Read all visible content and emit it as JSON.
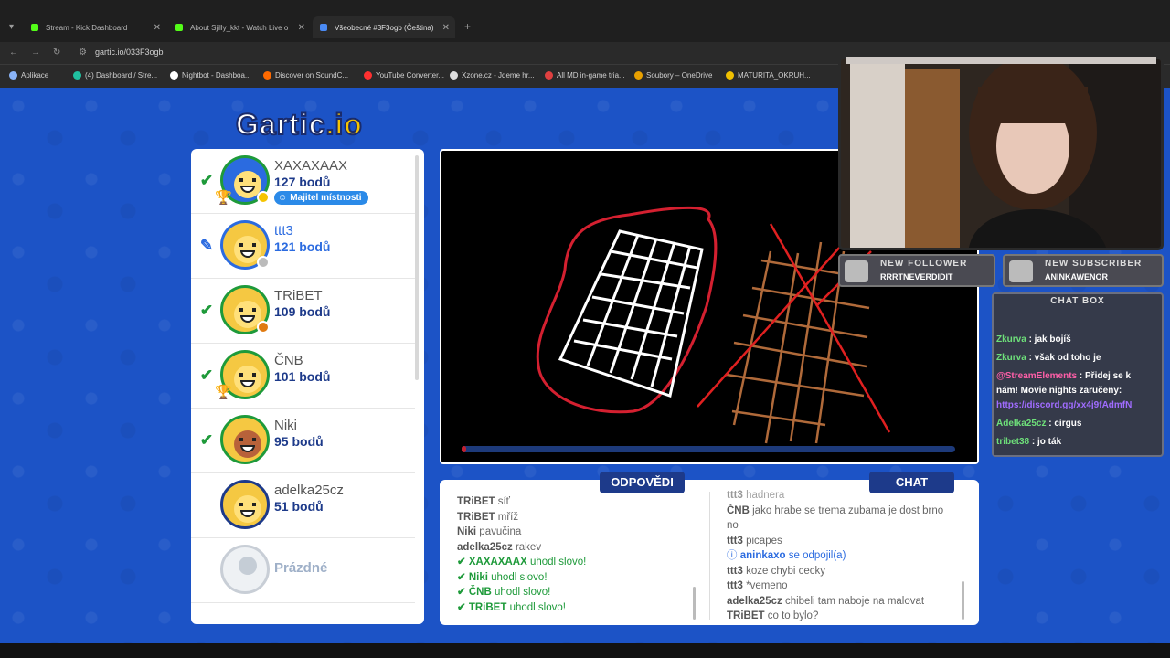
{
  "browser": {
    "tabs": [
      {
        "label": "Stream - Kick Dashboard",
        "color": "#53fc18"
      },
      {
        "label": "About Sjilly_kkt - Watch Live o",
        "color": "#53fc18"
      },
      {
        "label": "Všeobecné #3F3ogb (Čeština)",
        "color": "#4a8af4"
      }
    ],
    "new_tab": "+",
    "url": "gartic.io/033F3ogb",
    "bookmarks": [
      {
        "label": "Aplikace",
        "color": "#8ab4f8"
      },
      {
        "label": "(4) Dashboard / Stre...",
        "color": "#20c0a0"
      },
      {
        "label": "Nightbot - Dashboa...",
        "color": "#ffffff"
      },
      {
        "label": "Discover on SoundC...",
        "color": "#ff6a00"
      },
      {
        "label": "YouTube Converter...",
        "color": "#ff3030"
      },
      {
        "label": "Xzone.cz - Jdeme hr...",
        "color": "#dddddd"
      },
      {
        "label": "All MD in-game tria...",
        "color": "#e04040"
      },
      {
        "label": "Soubory – OneDrive",
        "color": "#e8a000"
      },
      {
        "label": "MATURITA_OKRUH...",
        "color": "#f0c000"
      }
    ]
  },
  "game": {
    "logo_main": "Gartic",
    "logo_suffix": ".io",
    "players": [
      {
        "name": "XAXAXAAX",
        "points": "127 bodů",
        "status": "check",
        "owner_badge": "Majitel místnosti",
        "trophy": true,
        "dot": "#f5c400",
        "hair": "#2b6be0"
      },
      {
        "name": "ttt3",
        "points": "121 bodů",
        "status": "pencil",
        "drawer": true,
        "dot": "#bbbbbb"
      },
      {
        "name": "TRiBET",
        "points": "109 bodů",
        "status": "check",
        "dot": "#e07a10"
      },
      {
        "name": "ČNB",
        "points": "101 bodů",
        "status": "check",
        "trophy": true
      },
      {
        "name": "Niki",
        "points": "95 bodů",
        "status": "check",
        "skin": "#b8623a"
      },
      {
        "name": "adelka25cz",
        "points": "51 bodů",
        "status": "none"
      },
      {
        "name": "Prázdné",
        "points": "",
        "status": "empty"
      }
    ],
    "timer_fraction": 0.01,
    "tabs": {
      "answers": "ODPOVĚDI",
      "chat": "CHAT"
    },
    "answers": [
      {
        "user": "TRiBET",
        "text": "síť",
        "type": "guess"
      },
      {
        "user": "TRiBET",
        "text": "mříž",
        "type": "guess"
      },
      {
        "user": "Niki",
        "text": "pavučina",
        "type": "guess"
      },
      {
        "user": "adelka25cz",
        "text": "rakev",
        "type": "guess"
      },
      {
        "user": "XAXAXAAX",
        "text": "uhodl slovo!",
        "type": "correct"
      },
      {
        "user": "Niki",
        "text": "uhodl slovo!",
        "type": "correct"
      },
      {
        "user": "ČNB",
        "text": "uhodl slovo!",
        "type": "correct"
      },
      {
        "user": "TRiBET",
        "text": "uhodl slovo!",
        "type": "correct"
      }
    ],
    "chat": [
      {
        "user": "ttt3",
        "text": "hadnera",
        "type": "msg"
      },
      {
        "user": "ČNB",
        "text": "jako hrabe se trema zubama je dost brno",
        "type": "msg"
      },
      {
        "user": "",
        "text": "no",
        "type": "cont"
      },
      {
        "user": "ttt3",
        "text": "picapes",
        "type": "msg"
      },
      {
        "user": "aninkaxo",
        "text": "se odpojil(a)",
        "type": "info"
      },
      {
        "user": "ttt3",
        "text": "koze chybi cecky",
        "type": "msg"
      },
      {
        "user": "ttt3",
        "text": "*vemeno",
        "type": "msg"
      },
      {
        "user": "adelka25cz",
        "text": "chibeli tam naboje na malovat",
        "type": "msg"
      },
      {
        "user": "TRiBET",
        "text": "co to bylo?",
        "type": "msg"
      }
    ]
  },
  "overlay": {
    "follower_title": "NEW FOLLOWER",
    "follower_name": "RRRTNEVERDIDIT",
    "subscriber_title": "NEW SUBSCRIBER",
    "subscriber_name": "ANINKAWENOR",
    "chatbox_title": "CHAT BOX",
    "chat": [
      {
        "user": "Zkurva",
        "text": ": jak bojíš",
        "color": "#6ee07a"
      },
      {
        "user": "Zkurva",
        "text": ": však od toho je",
        "color": "#6ee07a"
      },
      {
        "user": "@StreamElements",
        "text": ": Přidej se k",
        "color": "#ff5fa8"
      },
      {
        "user": "",
        "text": "nám! Movie nights zaručeny:",
        "color": ""
      },
      {
        "user": "",
        "text": "https://discord.gg/xx4j9fAdmfN",
        "color": "#a06cff"
      },
      {
        "user": "Adelka25cz",
        "text": ": cirgus",
        "color": "#6ee07a"
      },
      {
        "user": "tribet38",
        "text": ": jo ták",
        "color": "#6ee07a"
      }
    ]
  }
}
